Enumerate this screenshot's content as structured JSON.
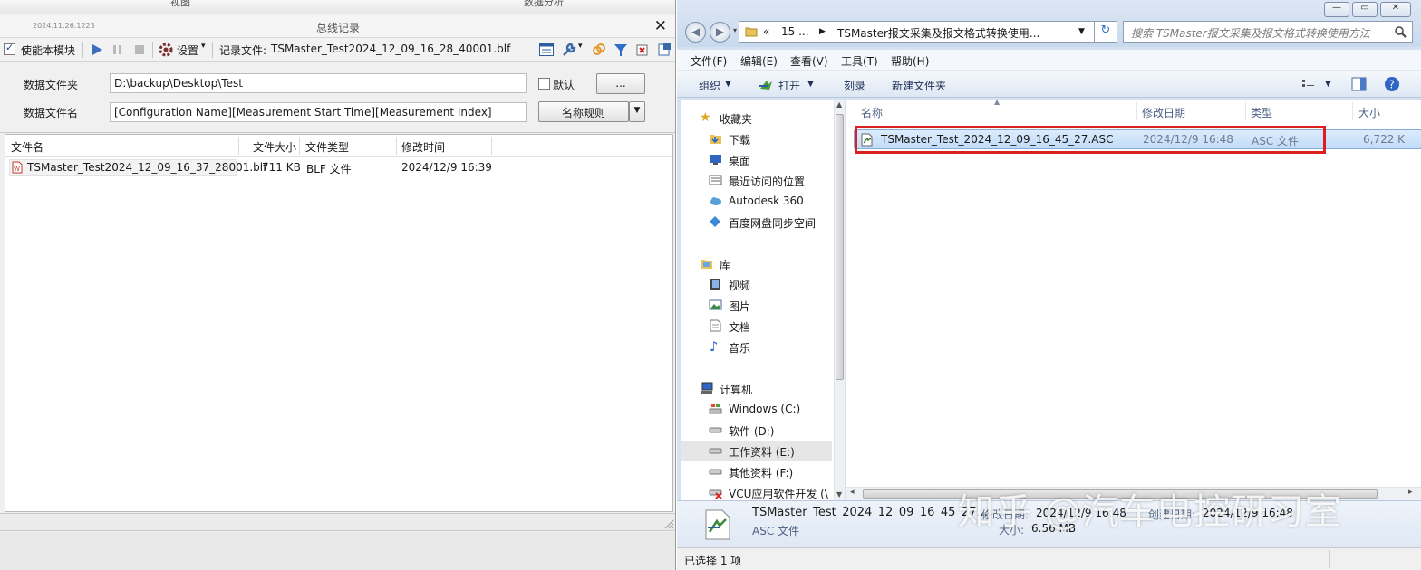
{
  "bus_log": {
    "top_tabs": [
      "视图",
      "数据分析"
    ],
    "version": "2024.11.26.1223",
    "title": "总线记录",
    "close_glyph": "✕",
    "toolbar": {
      "enable_label": "使能本模块",
      "settings_label": "设置",
      "record_file_label": "记录文件:",
      "record_file_value": "TSMaster_Test2024_12_09_16_28_40001.blf"
    },
    "data_folder_label": "数据文件夹",
    "data_folder_value": "D:\\backup\\Desktop\\Test",
    "default_label": "默认",
    "browse_label": "...",
    "data_filename_label": "数据文件名",
    "data_filename_value": "[Configuration Name][Measurement Start Time][Measurement Index]",
    "naming_rule_label": "名称规则",
    "columns": [
      "文件名",
      "文件大小",
      "文件类型",
      "修改时间"
    ],
    "files": [
      {
        "name": "TSMaster_Test2024_12_09_16_37_28001.blf",
        "size": "711 KB",
        "type": "BLF 文件",
        "modified": "2024/12/9 16:39"
      }
    ]
  },
  "explorer": {
    "window_buttons": [
      "—",
      "▭",
      "✕"
    ],
    "address": {
      "prefix": "«",
      "part1": "15 ...",
      "part2": "TSMaster报文采集及报文格式转换使用..."
    },
    "search_placeholder": "搜索 TSMaster报文采集及报文格式转换使用方法",
    "menu": [
      "文件(F)",
      "编辑(E)",
      "查看(V)",
      "工具(T)",
      "帮助(H)"
    ],
    "commands": {
      "organize": "组织",
      "open": "打开",
      "burn": "刻录",
      "new_folder": "新建文件夹"
    },
    "nav": {
      "favorites_header": "收藏夹",
      "favorites": [
        "下载",
        "桌面",
        "最近访问的位置",
        "Autodesk 360",
        "百度网盘同步空间"
      ],
      "libraries_header": "库",
      "libraries": [
        "视频",
        "图片",
        "文档",
        "音乐"
      ],
      "computer_header": "计算机",
      "drives": [
        "Windows (C:)",
        "软件 (D:)",
        "工作资料 (E:)",
        "其他资料 (F:)",
        "VCU应用软件开发 (\\"
      ]
    },
    "columns": [
      "名称",
      "修改日期",
      "类型",
      "大小"
    ],
    "files": [
      {
        "name": "TSMaster_Test_2024_12_09_16_45_27.ASC",
        "modified": "2024/12/9 16:48",
        "type": "ASC 文件",
        "size": "6,722 K"
      }
    ],
    "details": {
      "filename": "TSMaster_Test_2024_12_09_16_45_27....",
      "type": "ASC 文件",
      "modified_label": "修改日期:",
      "modified_value": "2024/12/9 16:48",
      "created_label": "创建日期:",
      "created_value": "2024/12/9 16:48",
      "size_label": "大小:",
      "size_value": "6.56 MB"
    },
    "status": "已选择 1 项"
  },
  "watermark": "知乎 @汽车电控研习室",
  "colors": {
    "highlight_box": "#d9201f",
    "selection": "#c1dcf8",
    "accent": "#1e3257"
  }
}
